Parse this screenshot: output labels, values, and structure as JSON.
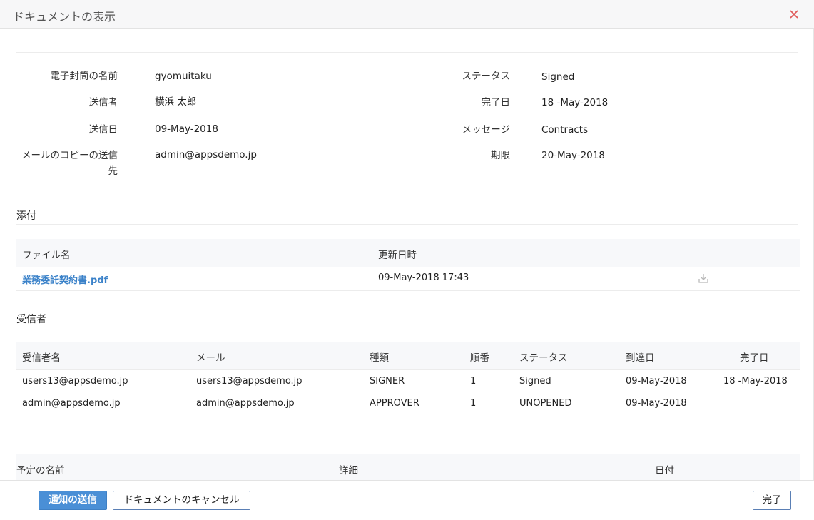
{
  "dialog": {
    "title": "ドキュメントの表示"
  },
  "info": {
    "left": [
      {
        "label": "電子封筒の名前",
        "value": "gyomuitaku"
      },
      {
        "label": "送信者",
        "value": "横浜 太郎"
      },
      {
        "label": "送信日",
        "value": "09-May-2018"
      },
      {
        "label_line1": "メールのコピーの送信",
        "label_line2": "先",
        "value": "admin@appsdemo.jp"
      }
    ],
    "right": [
      {
        "label": "ステータス",
        "value": "Signed"
      },
      {
        "label": "完了日",
        "value": "18 -May-2018"
      },
      {
        "label": "メッセージ",
        "value": "Contracts"
      },
      {
        "label": "期限",
        "value": "20-May-2018"
      }
    ]
  },
  "attachments": {
    "title": "添付",
    "headers": {
      "file_name": "ファイル名",
      "updated": "更新日時"
    },
    "rows": [
      {
        "file_name": "業務委託契約書.pdf",
        "updated": "09-May-2018 17:43"
      }
    ]
  },
  "recipients": {
    "title": "受信者",
    "headers": {
      "name": "受信者名",
      "mail": "メール",
      "type": "種類",
      "order": "順番",
      "status": "ステータス",
      "arrived": "到達日",
      "completed": "完了日"
    },
    "rows": [
      {
        "name": "users13@appsdemo.jp",
        "mail": "users13@appsdemo.jp",
        "type": "SIGNER",
        "order": "1",
        "status": "Signed",
        "arrived": "09-May-2018",
        "completed": "18 -May-2018"
      },
      {
        "name": "admin@appsdemo.jp",
        "mail": "admin@appsdemo.jp",
        "type": "APPROVER",
        "order": "1",
        "status": "UNOPENED",
        "arrived": "09-May-2018",
        "completed": ""
      }
    ]
  },
  "schedule": {
    "headers": {
      "name": "予定の名前",
      "detail": "詳細",
      "date": "日付"
    }
  },
  "footer": {
    "send_notice": "通知の送信",
    "cancel_document": "ドキュメントのキャンセル",
    "done": "完了"
  },
  "colors": {
    "close_icon": "#e05a5a",
    "link": "#3b82c9",
    "primary": "#4a8fd6"
  }
}
